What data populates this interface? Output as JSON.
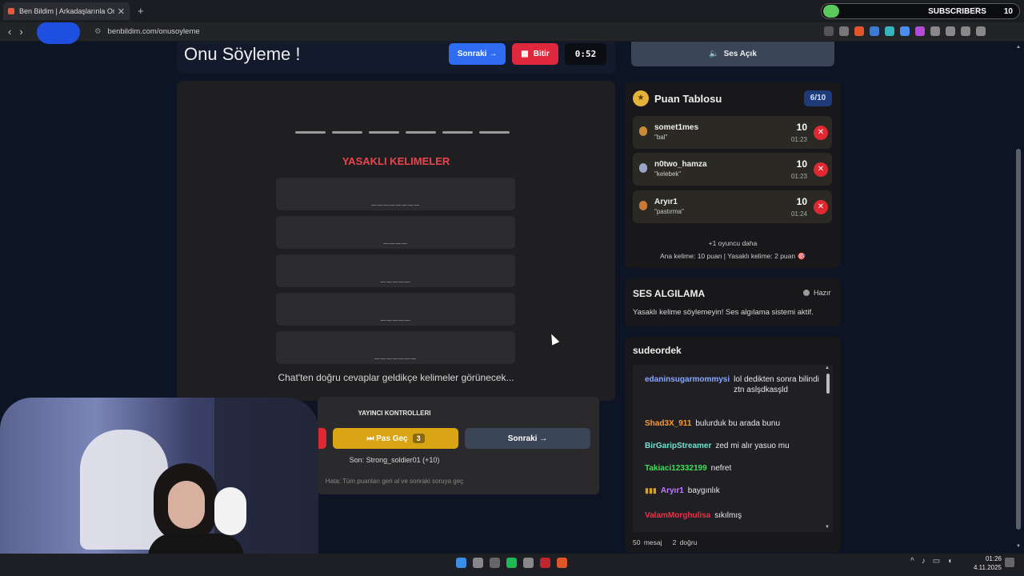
{
  "browser": {
    "tab_title": "Ben Bildim | Arkadaşlarınla Onlin",
    "url": "benbildim.com/onusoyleme",
    "subscribers_label": "SUBSCRIBERS",
    "subscribers_count": "10"
  },
  "game": {
    "title": "Onu Söyleme !",
    "next_label": "Sonraki →",
    "end_label": "Bitir",
    "timer": "0:52",
    "dash_count": 6,
    "forbidden_title": "YASAKLI KELIMELER",
    "forbidden_words": [
      "________",
      "____",
      "_____",
      "_____",
      "_______"
    ],
    "chat_note": "Chat'ten doğru cevaplar geldikçe kelimeler görünecek..."
  },
  "controls": {
    "title": "YAYINCI KONTROLLERI",
    "pass_label": "⏭ Pas Geç",
    "pass_count": "3",
    "next_label": "Sonraki →",
    "last_info": "Son: Strong_soldier01 (+10)",
    "error_info": "Hata: Tüm puanları geri al ve sonraki soruya geç"
  },
  "sound": {
    "button_label": "Ses Açık"
  },
  "scoreboard": {
    "title": "Puan Tablosu",
    "count": "6/10",
    "players": [
      {
        "name": "somet1mes",
        "answer": "\"bal\"",
        "points": "10",
        "time": "01:23",
        "medal_color": "#c98a3a"
      },
      {
        "name": "n0two_hamza",
        "answer": "\"kelebek\"",
        "points": "10",
        "time": "01:23",
        "medal_color": "#9aa3c8"
      },
      {
        "name": "Aryır1",
        "answer": "\"pastırma\"",
        "points": "10",
        "time": "01:24",
        "medal_color": "#c97a3a"
      }
    ],
    "more": "+1 oyuncu daha",
    "rules": "Ana kelime: 10 puan | Yasaklı kelime: 2 puan 🎯"
  },
  "voice": {
    "title": "SES ALGILAMA",
    "status": "Hazır",
    "description": "Yasaklı kelime söylemeyin! Ses algılama sistemi aktif."
  },
  "chat": {
    "owner": "sudeordek",
    "messages": [
      {
        "user": "edaninsugarmommysi",
        "text": "lol dedikten sonra bilindi ztn aslşdkasşld",
        "color": "#8aa7ff"
      },
      {
        "user": "Shad3X_911",
        "text": "bulurduk bu arada bunu",
        "color": "#ff9a2e"
      },
      {
        "user": "BirGaripStreamer",
        "text": "zed mi alır yasuo mu",
        "color": "#6fe3d0"
      },
      {
        "user": "Takiaci12332199",
        "text": "nefret",
        "color": "#3ee05a"
      },
      {
        "user": "Aryır1",
        "text": "baygınlık",
        "color": "#c07cff"
      },
      {
        "user": "ValamMorghulisa",
        "text": "sıkılmış",
        "color": "#e8314a"
      }
    ],
    "footer_count": "50 mesaj",
    "footer_correct": "2 doğru"
  },
  "taskbar": {
    "time": "01:26",
    "date": "4.11.2025"
  },
  "colors": {
    "accent_blue": "#2f6cf2",
    "accent_red": "#e0283c",
    "pass_yellow": "#d9a515"
  }
}
